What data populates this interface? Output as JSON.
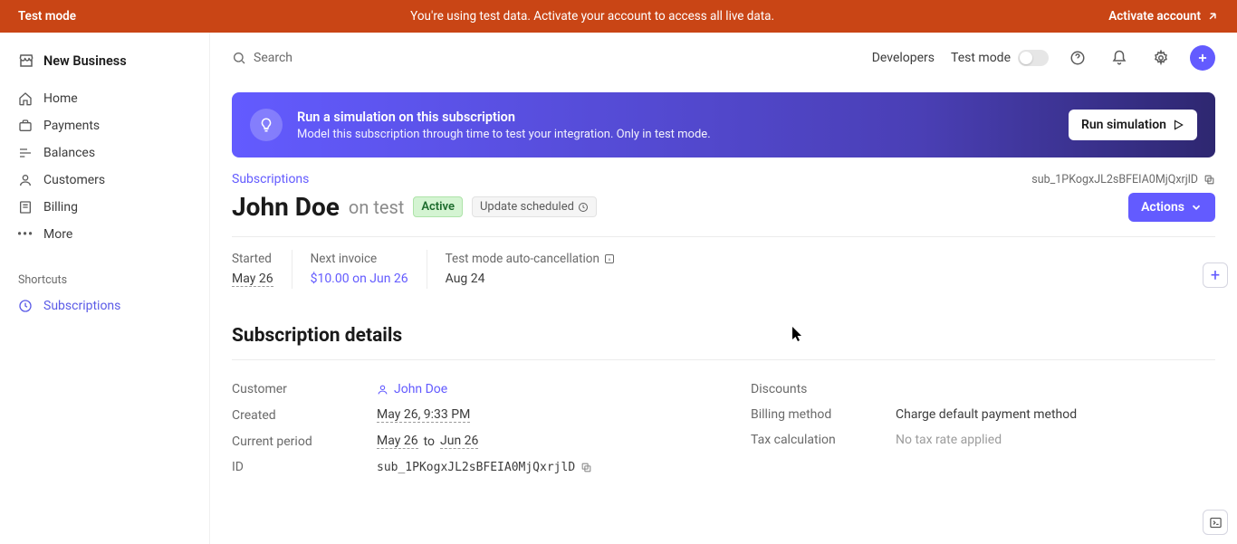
{
  "banner": {
    "label": "Test mode",
    "message": "You're using test data. Activate your account to access all live data.",
    "activate": "Activate account"
  },
  "brand": "New Business",
  "search_placeholder": "Search",
  "nav": {
    "home": "Home",
    "payments": "Payments",
    "balances": "Balances",
    "customers": "Customers",
    "billing": "Billing",
    "more": "More"
  },
  "shortcuts_label": "Shortcuts",
  "shortcuts": {
    "subscriptions": "Subscriptions"
  },
  "topbar": {
    "developers": "Developers",
    "test_mode": "Test mode"
  },
  "simulation": {
    "title": "Run a simulation on this subscription",
    "desc": "Model this subscription through time to test your integration. Only in test mode.",
    "button": "Run simulation"
  },
  "breadcrumb": "Subscriptions",
  "subscription_id": "sub_1PKogxJL2sBFEIA0MjQxrjlD",
  "customer_name": "John Doe",
  "on_text": "on",
  "plan_name": "test",
  "badge_active": "Active",
  "badge_scheduled": "Update scheduled",
  "actions_label": "Actions",
  "metrics": {
    "started_label": "Started",
    "started_value": "May 26",
    "next_invoice_label": "Next invoice",
    "next_invoice_value": "$10.00 on Jun 26",
    "auto_cancel_label": "Test mode auto-cancellation",
    "auto_cancel_value": "Aug 24"
  },
  "section_details": "Subscription details",
  "details": {
    "customer_label": "Customer",
    "customer_value": "John Doe",
    "created_label": "Created",
    "created_value": "May 26, 9:33 PM",
    "period_label": "Current period",
    "period_from": "May 26",
    "period_to_word": "to",
    "period_to": "Jun 26",
    "id_label": "ID",
    "id_value": "sub_1PKogxJL2sBFEIA0MjQxrjlD",
    "discounts_label": "Discounts",
    "discounts_value": "",
    "billing_method_label": "Billing method",
    "billing_method_value": "Charge default payment method",
    "tax_label": "Tax calculation",
    "tax_value": "No tax rate applied"
  }
}
